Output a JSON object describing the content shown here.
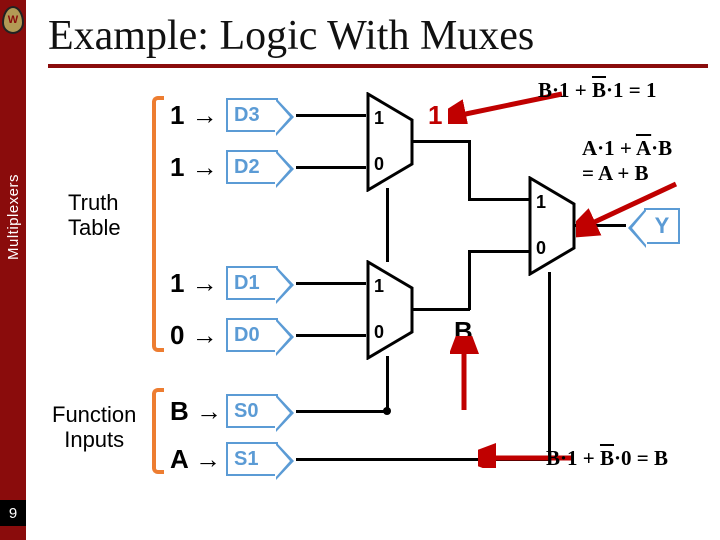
{
  "title": "Example: Logic With Muxes",
  "pageNumber": "9",
  "vertical": "Multiplexers",
  "badge": "W",
  "truthTable": "Truth\nTable",
  "functionInputs": "Function\nInputs",
  "inputs": {
    "d3": {
      "val": "1 →",
      "name": "D3"
    },
    "d2": {
      "val": "1 →",
      "name": "D2"
    },
    "d1": {
      "val": "1 →",
      "name": "D1"
    },
    "d0": {
      "val": "0 →",
      "name": "D0"
    },
    "s0": {
      "val": "B →",
      "name": "S0"
    },
    "s1": {
      "val": "A →",
      "name": "S1"
    }
  },
  "output": "Y",
  "muxLabels": {
    "hi": "1",
    "lo": "0"
  },
  "redOne": "1",
  "labelB": "B",
  "eq1": {
    "t1": "B·1 + ",
    "ov": "B",
    "t2": "·1 = 1"
  },
  "eq2": {
    "t1": "A·1 + ",
    "ov": "A",
    "t2": "·B",
    "t3": "= A + B"
  },
  "eq3": {
    "t1": "B·1 + ",
    "ov": "B",
    "t2": "·0 = B"
  },
  "chart_data": {
    "type": "diagram",
    "description": "Logic circuit with three 2:1 multiplexers showing truth table inputs D3-D0 and select inputs S0=B, S1=A producing output Y",
    "truth_table_inputs": [
      "1",
      "1",
      "1",
      "0"
    ],
    "select_inputs": [
      "B",
      "A"
    ],
    "equations": [
      "B·1 + B̄·1 = 1",
      "A·1 + Ā·B = A + B",
      "B·1 + B̄·0 = B"
    ]
  }
}
